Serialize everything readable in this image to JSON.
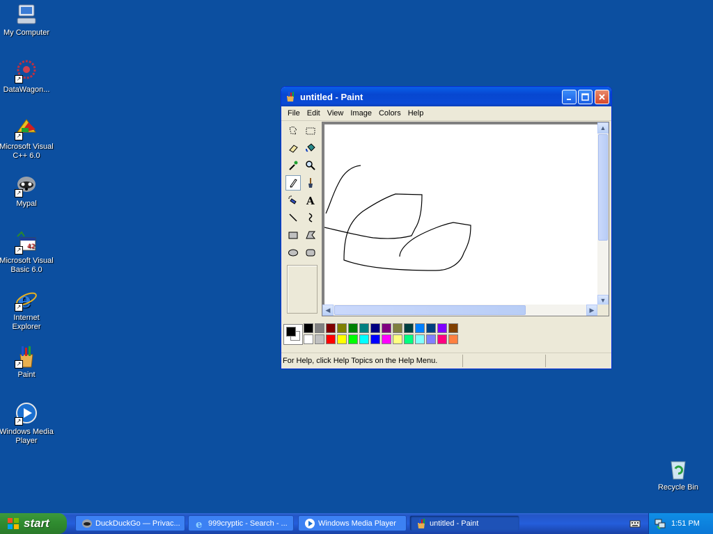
{
  "desktop": {
    "icons": [
      {
        "label": "My Computer",
        "icon": "my-computer-icon"
      },
      {
        "label": "DataWagon...",
        "icon": "datawagon-icon"
      },
      {
        "label": "Microsoft Visual C++ 6.0",
        "icon": "visual-cpp-icon"
      },
      {
        "label": "Mypal",
        "icon": "mypal-icon"
      },
      {
        "label": "Microsoft Visual Basic 6.0",
        "icon": "visual-basic-icon"
      },
      {
        "label": "Internet Explorer",
        "icon": "internet-explorer-icon"
      },
      {
        "label": "Paint",
        "icon": "paint-icon"
      },
      {
        "label": "Windows Media Player",
        "icon": "windows-media-player-icon"
      }
    ],
    "recycle_bin": {
      "label": "Recycle Bin",
      "icon": "recycle-bin-icon"
    },
    "background_color": "#0c4fa0"
  },
  "window": {
    "title": "untitled - Paint",
    "menu": [
      "File",
      "Edit",
      "View",
      "Image",
      "Colors",
      "Help"
    ],
    "tools": [
      "free-form-select",
      "select",
      "eraser",
      "fill-with-color",
      "pick-color",
      "magnifier",
      "pencil",
      "brush",
      "airbrush",
      "text",
      "line",
      "curve",
      "rectangle",
      "polygon",
      "ellipse",
      "rounded-rectangle"
    ],
    "active_tool": "pencil",
    "palette_row1": [
      "#000000",
      "#808080",
      "#800000",
      "#808000",
      "#008000",
      "#008080",
      "#000080",
      "#800080",
      "#808040",
      "#004040",
      "#0080ff",
      "#004080",
      "#8000ff",
      "#804000"
    ],
    "palette_row2": [
      "#ffffff",
      "#c0c0c0",
      "#ff0000",
      "#ffff00",
      "#00ff00",
      "#00ffff",
      "#0000ff",
      "#ff00ff",
      "#ffff80",
      "#00ff80",
      "#80ffff",
      "#8080ff",
      "#ff0080",
      "#ff8040"
    ],
    "foreground_color": "#000000",
    "background_color": "#ffffff",
    "status_text": "For Help, click Help Topics on the Help Menu."
  },
  "taskbar": {
    "start_label": "start",
    "tasks": [
      {
        "label": "DuckDuckGo — Privac...",
        "icon": "mypal-icon",
        "active": false
      },
      {
        "label": "999cryptic - Search - ...",
        "icon": "internet-explorer-icon",
        "active": false
      },
      {
        "label": "Windows Media Player",
        "icon": "windows-media-player-icon",
        "active": false
      },
      {
        "label": "untitled - Paint",
        "icon": "paint-icon",
        "active": true
      }
    ],
    "clock": "1:51 PM"
  }
}
